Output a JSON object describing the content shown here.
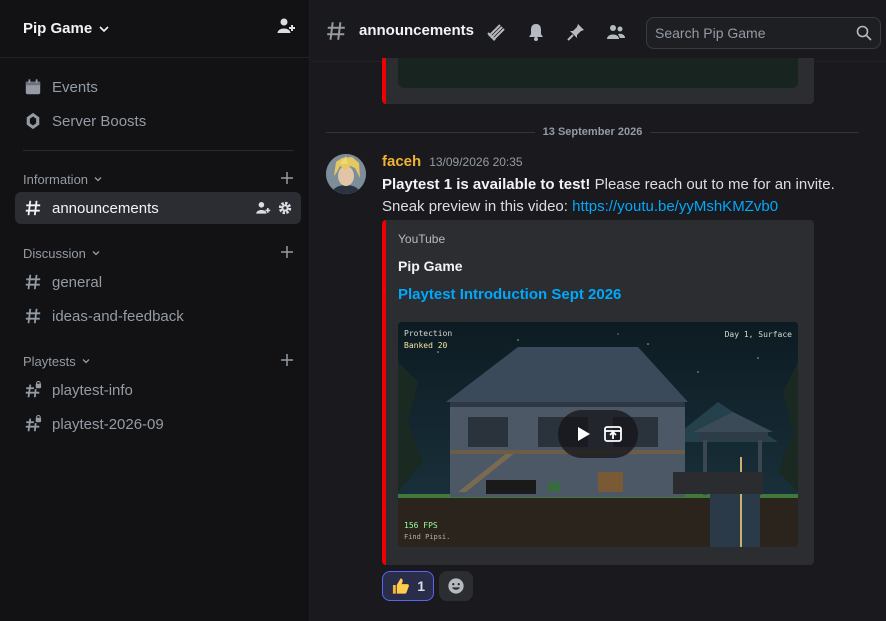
{
  "server": {
    "name": "Pip Game"
  },
  "sidebar": {
    "top_items": [
      {
        "label": "Events",
        "icon": "calendar-icon"
      },
      {
        "label": "Server Boosts",
        "icon": "boost-gem-icon"
      }
    ],
    "categories": [
      {
        "label": "Information",
        "channels": [
          {
            "label": "announcements",
            "icon": "hash-icon",
            "active": true
          }
        ]
      },
      {
        "label": "Discussion",
        "channels": [
          {
            "label": "general",
            "icon": "hash-icon"
          },
          {
            "label": "ideas-and-feedback",
            "icon": "hash-icon"
          }
        ]
      },
      {
        "label": "Playtests",
        "channels": [
          {
            "label": "playtest-info",
            "icon": "locked-hash-icon"
          },
          {
            "label": "playtest-2026-09",
            "icon": "locked-hash-icon"
          }
        ]
      }
    ]
  },
  "header": {
    "channel": "announcements",
    "search_placeholder": "Search Pip Game",
    "icons": [
      "threads-icon",
      "bell-icon",
      "pin-icon",
      "members-icon",
      "search-icon"
    ]
  },
  "messages": {
    "date_separator": "13 September 2026",
    "author": "faceh",
    "timestamp": "13/09/2026 20:35",
    "bold_text": "Playtest 1 is available to test!",
    "text_after_bold": " Please reach out to me for an invite.",
    "text_line2": "Sneak preview in this video: ",
    "link": "https://youtu.be/yyMshKMZvb0",
    "embed": {
      "provider": "YouTube",
      "author": "Pip Game",
      "title": "Playtest Introduction Sept 2026",
      "video": {
        "hud_protection": "Protection",
        "hud_banked_label": "Banked",
        "hud_banked_value": "20",
        "hud_day": "Day 1, Surface",
        "hud_fps": "156 FPS",
        "hud_hint": "Find Pipsi."
      }
    },
    "reactions": [
      {
        "emoji": "thumbs-up-icon",
        "count": "1"
      }
    ]
  },
  "colors": {
    "accent_link": "#00a8fc",
    "author_color": "#f0b232",
    "embed_border": "#ee0000",
    "sidebar_bg": "#121214",
    "main_bg": "#1a1a1e"
  }
}
